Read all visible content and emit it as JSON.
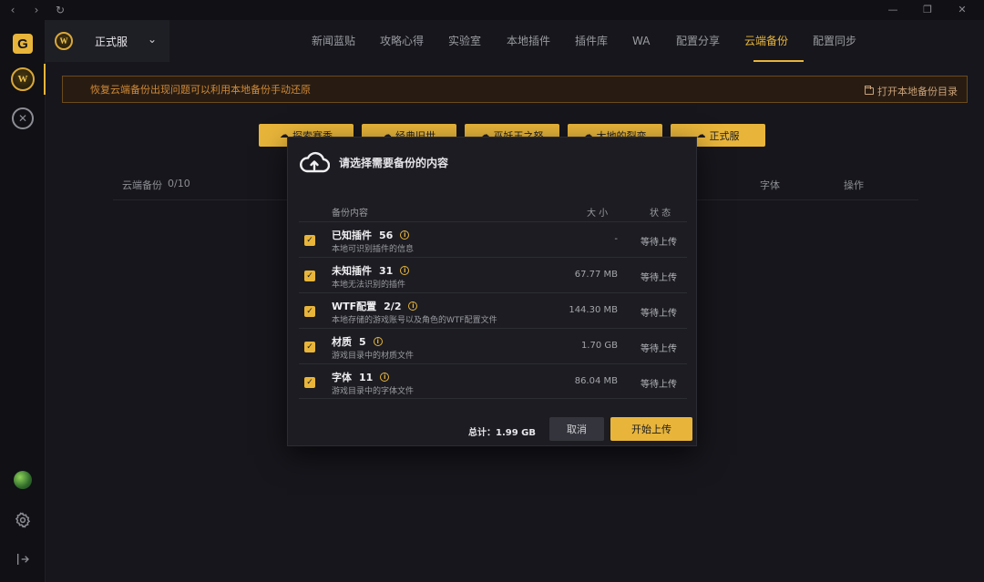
{
  "titlebar": {
    "back": "‹",
    "forward": "›",
    "refresh": "↻",
    "minimize": "—",
    "restore": "❐",
    "close": "✕"
  },
  "rail": {
    "logo_letter": "G",
    "game_badge": "W",
    "sc_badge": "✕"
  },
  "server": {
    "badge": "W",
    "name": "正式服",
    "chevron": "⌄"
  },
  "nav": [
    "新闻蓝贴",
    "攻略心得",
    "实验室",
    "本地插件",
    "插件库",
    "WA",
    "配置分享",
    "云端备份",
    "配置同步"
  ],
  "nav_active": "云端备份",
  "notice": {
    "text": "恢复云端备份出现问题可以利用本地备份手动还原",
    "link": "打开本地备份目录"
  },
  "bg_buttons": [
    "探索赛季",
    "经典旧世",
    "巫妖王之怒",
    "大地的裂变",
    "正式服"
  ],
  "bg_table": {
    "title": "云端备份",
    "count": "0/10",
    "col_font": "字体",
    "col_action": "操作"
  },
  "modal": {
    "title": "请选择需要备份的内容",
    "headers": {
      "content": "备份内容",
      "size": "大 小",
      "status": "状 态"
    },
    "rows": [
      {
        "name": "已知插件",
        "count": "56",
        "desc": "本地可识别插件的信息",
        "size": "-",
        "status": "等待上传"
      },
      {
        "name": "未知插件",
        "count": "31",
        "desc": "本地无法识别的插件",
        "size": "67.77 MB",
        "status": "等待上传"
      },
      {
        "name": "WTF配置",
        "count": "2/2",
        "desc": "本地存储的游戏账号以及角色的WTF配置文件",
        "size": "144.30 MB",
        "status": "等待上传"
      },
      {
        "name": "材质",
        "count": "5",
        "desc": "游戏目录中的材质文件",
        "size": "1.70 GB",
        "status": "等待上传"
      },
      {
        "name": "字体",
        "count": "11",
        "desc": "游戏目录中的字体文件",
        "size": "86.04 MB",
        "status": "等待上传"
      }
    ],
    "total": "总计：1.99 GB",
    "cancel": "取消",
    "upload": "开始上传"
  },
  "colors": {
    "accent": "#e8b53a",
    "bg": "#16161c",
    "modal_bg": "#1c1c22",
    "notice_text": "#d18a37"
  }
}
